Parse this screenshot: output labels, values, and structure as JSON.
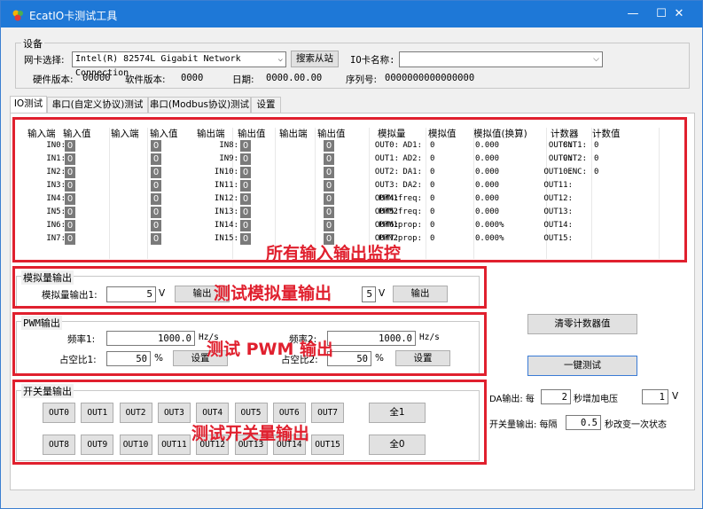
{
  "window": {
    "title": "EcatIO卡测试工具",
    "min": "—",
    "max": "☐",
    "close": "✕"
  },
  "device": {
    "group_title": "设备",
    "nic_label": "网卡选择:",
    "nic_value": "Intel(R) 82574L Gigabit Network Connection",
    "search_btn": "搜索从站",
    "io_name_label": "IO卡名称:",
    "io_name_value": "",
    "hw_label": "硬件版本:",
    "hw_value": "00000",
    "sw_label": "软件版本:",
    "sw_value": "0000",
    "date_label": "日期:",
    "date_value": "0000.00.00",
    "serial_label": "序列号:",
    "serial_value": "0000000000000000"
  },
  "tabs": [
    "IO测试",
    "串口(自定义协议)测试",
    "串口(Modbus协议)测试",
    "设置"
  ],
  "monitor": {
    "headers": [
      "输入端",
      "输入值",
      "输入端",
      "输入值",
      "输出端",
      "输出值",
      "输出端",
      "输出值",
      "模拟量",
      "模拟值",
      "模拟值(换算)",
      "计数器",
      "计数值"
    ],
    "in_a": [
      "IN0:",
      "IN1:",
      "IN2:",
      "IN3:",
      "IN4:",
      "IN5:",
      "IN6:",
      "IN7:"
    ],
    "in_b": [
      "IN8:",
      "IN9:",
      "IN10:",
      "IN11:",
      "IN12:",
      "IN13:",
      "IN14:",
      "IN15:"
    ],
    "out_a": [
      "OUT0:",
      "OUT1:",
      "OUT2:",
      "OUT3:",
      "OUT4:",
      "OUT5:",
      "OUT6:",
      "OUT7:"
    ],
    "out_b": [
      "OUT8:",
      "OUT9:",
      "OUT10:",
      "OUT11:",
      "OUT12:",
      "OUT13:",
      "OUT14:",
      "OUT15:"
    ],
    "bit_value": "0",
    "analog_names": [
      "AD1:",
      "AD2:",
      "DA1:",
      "DA2:",
      "PWM1freq:",
      "PWM2freq:",
      "PWM1prop:",
      "PWM2prop:"
    ],
    "analog_values": [
      "0",
      "0",
      "0",
      "0",
      "0",
      "0",
      "0",
      "0"
    ],
    "analog_conv": [
      "0.000",
      "0.000",
      "0.000",
      "0.000",
      "0.000",
      "0.000",
      "0.000%",
      "0.000%"
    ],
    "counter_names": [
      "CNT1:",
      "CNT2:",
      "ENC:"
    ],
    "counter_values": [
      "0",
      "0",
      "0"
    ],
    "annotation": "所有输入输出监控"
  },
  "analog_out": {
    "title": "模拟量输出",
    "label1": "模拟量输出1:",
    "value1": "5",
    "unit1": "V",
    "btn1": "输出",
    "value2": "5",
    "unit2": "V",
    "btn2": "输出",
    "annotation": "测试模拟量输出"
  },
  "pwm": {
    "title": "PWM输出",
    "freq1_label": "频率1:",
    "freq1_value": "1000.0",
    "freq_unit1": "Hz/s",
    "freq2_label": "频率2:",
    "freq2_value": "1000.0",
    "freq_unit2": "Hz/s",
    "duty1_label": "占空比1:",
    "duty1_value": "50",
    "duty_unit1": "%",
    "set1": "设置",
    "duty2_label": "占空比2:",
    "duty2_value": "50",
    "duty_unit2": "%",
    "set2": "设置",
    "annotation": "测试 PWM 输出"
  },
  "switch_out": {
    "title": "开关量输出",
    "row1": [
      "OUT0",
      "OUT1",
      "OUT2",
      "OUT3",
      "OUT4",
      "OUT5",
      "OUT6",
      "OUT7"
    ],
    "row2": [
      "OUT8",
      "OUT9",
      "OUT10",
      "OUT11",
      "OUT12",
      "OUT13",
      "OUT14",
      "OUT15"
    ],
    "all1": "全1",
    "all0": "全0",
    "annotation": "测试开关量输出"
  },
  "right": {
    "clear_btn": "清零计数器值",
    "onekey_btn": "一键测试",
    "da_label1": "DA输出: 每",
    "da_interval": "2",
    "da_label2": "秒增加电压",
    "da_voltage": "1",
    "da_unit": "V",
    "sw_label1": "开关量输出: 每隔",
    "sw_interval": "0.5",
    "sw_label2": "秒改变一次状态"
  }
}
